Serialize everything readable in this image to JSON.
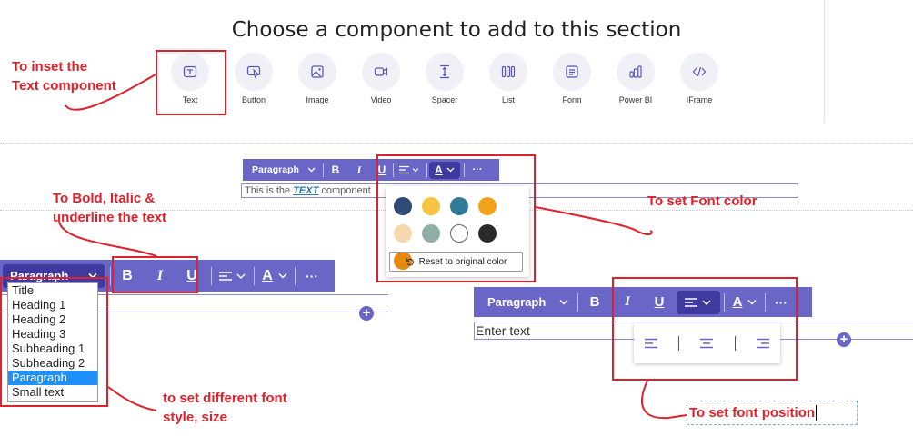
{
  "heading": "Choose a component to add to this section",
  "components": [
    {
      "label": "Text",
      "icon": "text-icon"
    },
    {
      "label": "Button",
      "icon": "button-cursor-icon"
    },
    {
      "label": "Image",
      "icon": "image-icon"
    },
    {
      "label": "Video",
      "icon": "video-icon"
    },
    {
      "label": "Spacer",
      "icon": "spacer-icon"
    },
    {
      "label": "List",
      "icon": "list-icon"
    },
    {
      "label": "Form",
      "icon": "form-icon"
    },
    {
      "label": "Power BI",
      "icon": "power-bi-icon"
    },
    {
      "label": "IFrame",
      "icon": "code-icon"
    }
  ],
  "annotations": {
    "insert_text_line1": "To inset the",
    "insert_text_line2": "Text component",
    "bold_line1": "To Bold, Italic &",
    "bold_line2": "underline the text",
    "font_color": "To set Font color",
    "font_style_line1": "to set different font",
    "font_style_line2": "style, size",
    "font_position": "To set font position"
  },
  "toolbar": {
    "paragraph": "Paragraph",
    "bold": "B",
    "italic": "I",
    "underline": "U",
    "font_color": "A",
    "more": "···"
  },
  "sample_text": {
    "before": "This is the ",
    "emphasis": "TEXT",
    "after": " component"
  },
  "color_picker": {
    "swatches": [
      "#2f4a74",
      "#f6c443",
      "#2f7b98",
      "#f2a31b",
      "#f5d9ac",
      "#8faea6",
      "#ffffff",
      "#2a2a2a",
      "#e8890f"
    ],
    "reset_label": "Reset to original color"
  },
  "style_dropdown": {
    "options": [
      "Title",
      "Heading 1",
      "Heading 2",
      "Heading 3",
      "Subheading 1",
      "Subheading 2",
      "Paragraph",
      "Small text"
    ],
    "selected": "Paragraph"
  },
  "enter_text_placeholder": "Enter text",
  "colors": {
    "accent": "#6a66c7",
    "accent_dark": "#3e3aa0",
    "annotation_red": "#e0202a",
    "selection_blue": "#1e90ff"
  }
}
